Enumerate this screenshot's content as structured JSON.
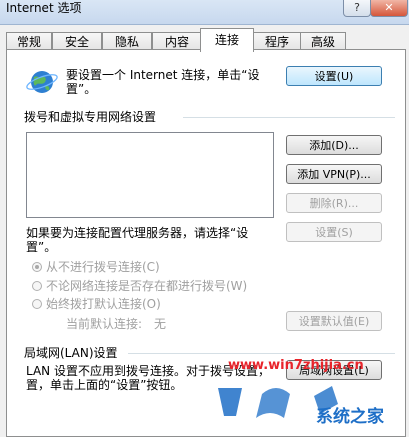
{
  "window": {
    "title": "Internet 选项",
    "help_glyph": "?",
    "close_glyph": "✕"
  },
  "tabs": [
    {
      "label": "常规"
    },
    {
      "label": "安全"
    },
    {
      "label": "隐私"
    },
    {
      "label": "内容"
    },
    {
      "label": "连接"
    },
    {
      "label": "程序"
    },
    {
      "label": "高级"
    }
  ],
  "setup": {
    "text_line1": "要设置一个 Internet 连接，单击“设",
    "text_line2": "置”。",
    "button": "设置(U)"
  },
  "dialup": {
    "group_label": "拨号和虚拟专用网络设置",
    "add_button": "添加(D)...",
    "add_vpn_button": "添加 VPN(P)...",
    "delete_button": "删除(R)...",
    "proxy_text_line1": "如果要为连接配置代理服务器，请选择“设",
    "proxy_text_line2": "置”。",
    "settings_button": "设置(S)",
    "radio_never": "从不进行拨号连接(C)",
    "radio_when_no_network": "不论网络连接是否存在都进行拨号(W)",
    "radio_always": "始终拨打默认连接(O)",
    "current_default_label": "当前默认连接:",
    "current_default_value": "无",
    "set_default_button": "设置默认值(E)"
  },
  "lan": {
    "group_label": "局域网(LAN)设置",
    "text_line1": "LAN 设置不应用到拨号连接。对于拨号设置，",
    "text_line2": "置，单击上面的“设置”按钮。",
    "button": "局域网设置(L)"
  },
  "watermark": {
    "url": "www.win7zhijia.cn",
    "brand": "系统之家",
    "logo_text": "Win7"
  },
  "colors": {
    "watermark_red": "#e8242b",
    "watermark_blue": "#1e6fc7"
  }
}
